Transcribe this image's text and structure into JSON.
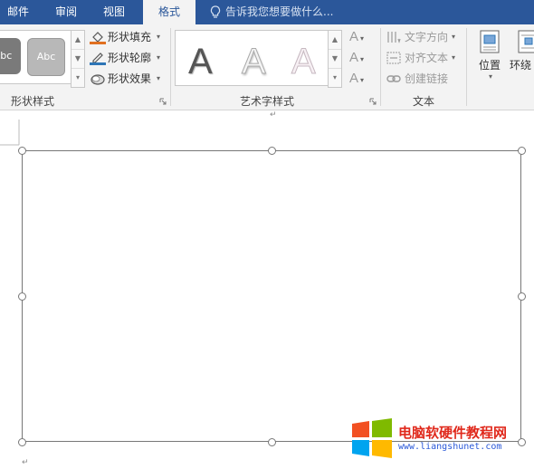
{
  "tabs": [
    {
      "label": "邮件",
      "active": false
    },
    {
      "label": "审阅",
      "active": false
    },
    {
      "label": "视图",
      "active": false
    },
    {
      "label": "格式",
      "active": true
    }
  ],
  "tell_me": {
    "placeholder": "告诉我您想要做什么..."
  },
  "groups": {
    "shape_styles": {
      "label": "形状样式",
      "thumbs": [
        "Abc",
        "Abc"
      ],
      "commands": [
        {
          "label": "形状填充",
          "icon": "paint-bucket-icon"
        },
        {
          "label": "形状轮廓",
          "icon": "pen-icon"
        },
        {
          "label": "形状效果",
          "icon": "shape-effects-icon"
        }
      ]
    },
    "wordart": {
      "label": "艺术字样式",
      "letters": [
        "A",
        "A",
        "A"
      ]
    },
    "text": {
      "label": "文本",
      "commands": [
        {
          "label": "文字方向",
          "icon": "text-direction-icon"
        },
        {
          "label": "对齐文本",
          "icon": "align-text-icon"
        },
        {
          "label": "创建链接",
          "icon": "link-icon"
        }
      ]
    },
    "arrange": {
      "position_label": "位置",
      "wrap_label": "环绕"
    }
  },
  "watermark": {
    "title": "电脑软硬件教程网",
    "url": "www.liangshunet.com",
    "colors": [
      "#f25022",
      "#7fba00",
      "#00a4ef",
      "#ffb900"
    ]
  },
  "colors": {
    "ribbon_blue": "#2b579a",
    "ribbon_bg": "#f3f3f3",
    "fill_swatch": "#e07020",
    "outline_swatch": "#2e75b6"
  }
}
